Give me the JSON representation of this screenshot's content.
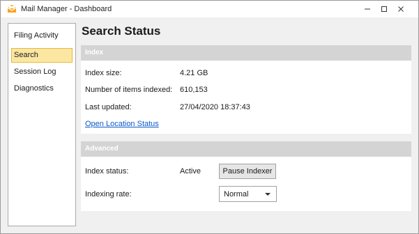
{
  "window": {
    "title": "Mail Manager - Dashboard",
    "icons": {
      "app": "mail-manager-app-icon",
      "minimize": "minimize-icon",
      "maximize": "maximize-icon",
      "close": "close-icon"
    }
  },
  "sidebar": {
    "items": [
      {
        "label": "Filing Activity"
      },
      {
        "label": "Search"
      },
      {
        "label": "Session Log"
      },
      {
        "label": "Diagnostics"
      }
    ],
    "selected": "Search",
    "selected_bg": "#fbe6a2",
    "selected_border": "#e3b93c"
  },
  "page": {
    "title": "Search Status"
  },
  "index_section": {
    "header": "Index",
    "rows": [
      {
        "label": "Index size:",
        "value": "4.21 GB"
      },
      {
        "label": "Number of items indexed:",
        "value": "610,153"
      },
      {
        "label": "Last updated:",
        "value": "27/04/2020 18:37:43"
      }
    ],
    "link_label": "Open Location Status",
    "link_color": "#0a58c9"
  },
  "advanced_section": {
    "header": "Advanced",
    "status_label": "Index status:",
    "status_value": "Active",
    "pause_button_label": "Pause Indexer",
    "rate_label": "Indexing rate:",
    "rate_value": "Normal"
  },
  "colors": {
    "section_header_bg": "#d4d4d4",
    "content_bg": "#f0f0f0"
  }
}
